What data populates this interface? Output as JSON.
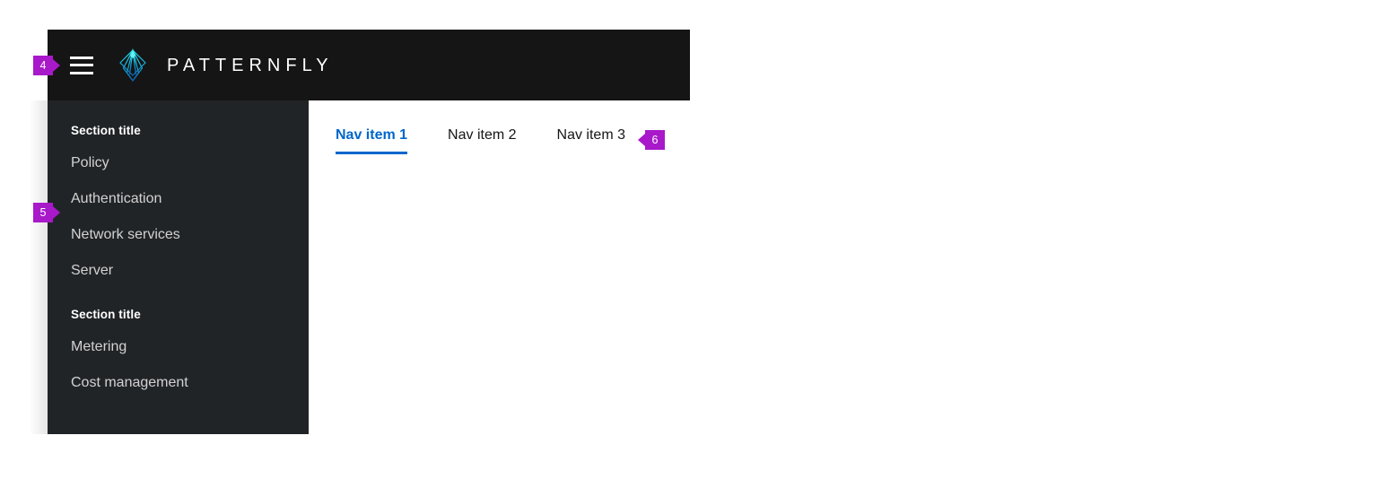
{
  "masthead": {
    "toggle_icon": "hamburger-menu-icon",
    "logo_icon": "patternfly-diamond-logo-icon",
    "brand_name": "PATTERNFLY",
    "background": "#151515"
  },
  "sidebar": {
    "background": "#212427",
    "sections": [
      {
        "title": "Section title",
        "items": [
          {
            "label": "Policy"
          },
          {
            "label": "Authentication"
          },
          {
            "label": "Network services"
          },
          {
            "label": "Server"
          }
        ]
      },
      {
        "title": "Section title",
        "items": [
          {
            "label": "Metering"
          },
          {
            "label": "Cost management"
          }
        ]
      }
    ]
  },
  "tabs": {
    "active_color": "#0066cc",
    "items": [
      {
        "label": "Nav item 1",
        "active": true
      },
      {
        "label": "Nav item 2",
        "active": false
      },
      {
        "label": "Nav item 3",
        "active": false
      }
    ]
  },
  "callouts": {
    "color": "#a819c9",
    "items": [
      {
        "number": "4",
        "direction": "right"
      },
      {
        "number": "5",
        "direction": "right"
      },
      {
        "number": "6",
        "direction": "left"
      }
    ]
  }
}
